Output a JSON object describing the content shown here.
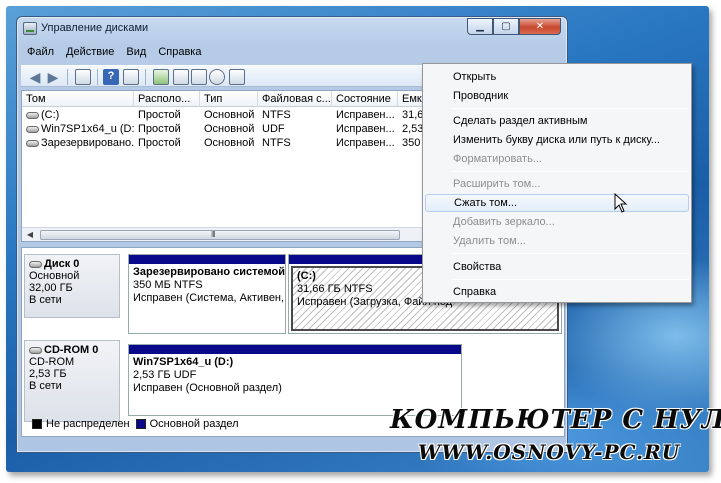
{
  "window": {
    "title": "Управление дисками",
    "buttons": {
      "minimize": "▁",
      "maximize": "▢",
      "close": "✕"
    }
  },
  "menu": [
    "Файл",
    "Действие",
    "Вид",
    "Справка"
  ],
  "toolbar": {
    "icons": [
      "back-arrow-icon",
      "forward-arrow-icon",
      "console-tree-icon",
      "help-icon",
      "properties-icon",
      "refresh-icon",
      "settings-icon",
      "search-icon",
      "console-icon"
    ],
    "help_glyph": "?"
  },
  "volumes": {
    "columns": [
      "Том",
      "Располо...",
      "Тип",
      "Файловая с...",
      "Состояние",
      "Емк"
    ],
    "rows": [
      [
        "(C:)",
        "Простой",
        "Основной",
        "NTFS",
        "Исправен...",
        "31,6"
      ],
      [
        "Win7SP1x64_u (D:)",
        "Простой",
        "Основной",
        "UDF",
        "Исправен...",
        "2,53"
      ],
      [
        "Зарезервировано...",
        "Простой",
        "Основной",
        "NTFS",
        "Исправен...",
        "350"
      ]
    ],
    "scroll_grip": "III"
  },
  "disks": [
    {
      "name": "Диск 0",
      "type": "Основной",
      "size": "32,00 ГБ",
      "status": "В сети",
      "partitions": [
        {
          "title": "Зарезервировано системой",
          "size_fs": "350 МБ NTFS",
          "status": "Исправен (Система, Активен, С"
        },
        {
          "title": "(C:)",
          "size_fs": "31,66 ГБ NTFS",
          "status": "Исправен (Загрузка, Файл под"
        }
      ]
    },
    {
      "name": "CD-ROM 0",
      "type": "CD-ROM",
      "size": "2,53 ГБ",
      "status": "В сети",
      "partitions": [
        {
          "title": "Win7SP1x64_u  (D:)",
          "size_fs": "2,53 ГБ UDF",
          "status": "Исправен (Основной раздел)"
        }
      ]
    }
  ],
  "legend": [
    {
      "label": "Не распределен",
      "color": "#000000"
    },
    {
      "label": "Основной раздел",
      "color": "#08088a"
    }
  ],
  "context_menu": [
    {
      "label": "Открыть",
      "disabled": false
    },
    {
      "label": "Проводник",
      "disabled": false
    },
    {
      "label": "Сделать раздел активным",
      "disabled": false
    },
    {
      "label": "Изменить букву диска или путь к диску...",
      "disabled": false
    },
    {
      "label": "Форматировать...",
      "disabled": true
    },
    {
      "label": "Расширить том...",
      "disabled": true
    },
    {
      "label": "Сжать том...",
      "disabled": false,
      "hover": true
    },
    {
      "label": "Добавить зеркало...",
      "disabled": true
    },
    {
      "label": "Удалить том...",
      "disabled": true
    },
    {
      "label": "Свойства",
      "disabled": false
    },
    {
      "label": "Справка",
      "disabled": false
    }
  ],
  "watermark": {
    "line1": "КОМПЬЮТЕР С НУЛЯ",
    "line2": "WWW.OSNOVY-PC.RU"
  }
}
